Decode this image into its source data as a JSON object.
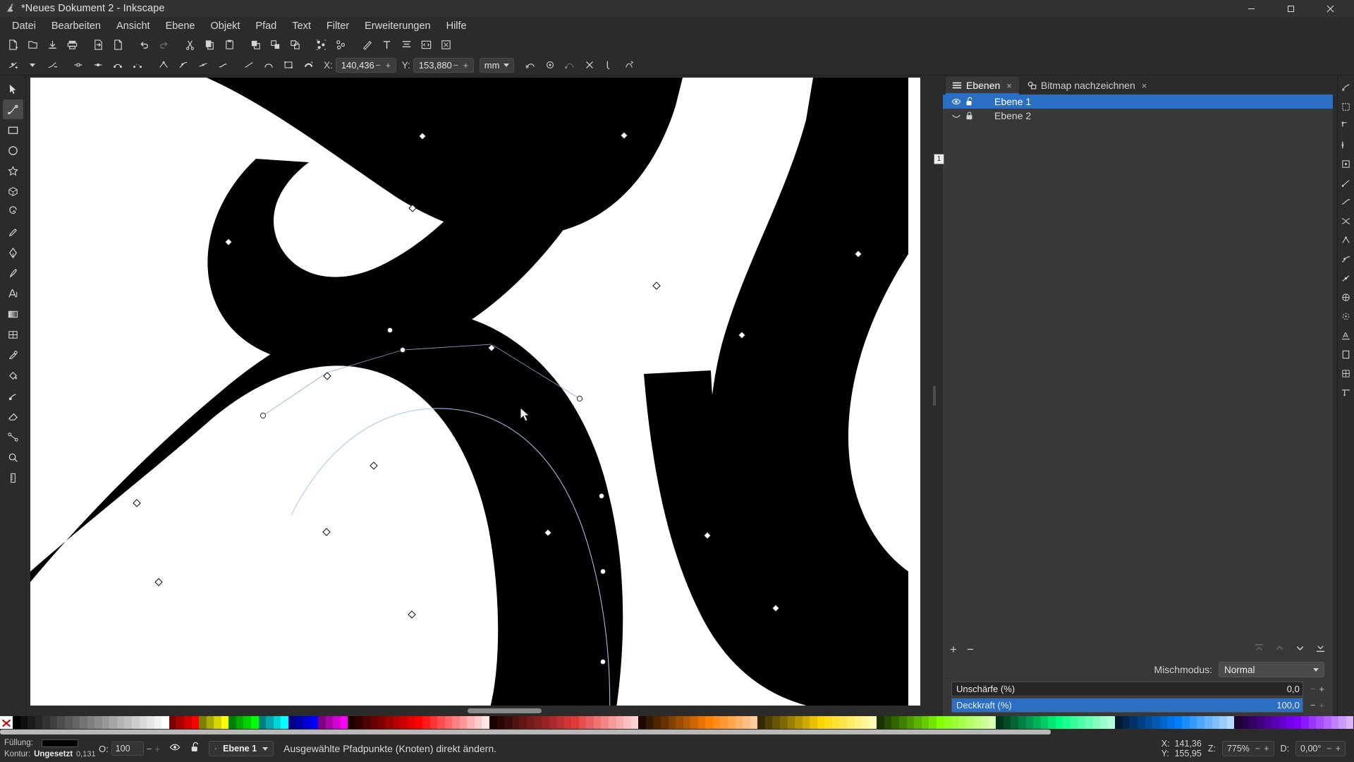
{
  "window": {
    "title": "*Neues Dokument 2 - Inkscape",
    "logo_icon": "inkscape-logo-icon",
    "minimize_label": "–",
    "maximize_label": "❐",
    "close_label": "✕"
  },
  "menubar": {
    "items": [
      {
        "label": "Datei"
      },
      {
        "label": "Bearbeiten"
      },
      {
        "label": "Ansicht"
      },
      {
        "label": "Ebene"
      },
      {
        "label": "Objekt"
      },
      {
        "label": "Pfad"
      },
      {
        "label": "Text"
      },
      {
        "label": "Filter"
      },
      {
        "label": "Erweiterungen"
      },
      {
        "label": "Hilfe"
      }
    ]
  },
  "command_toolbar": {
    "buttons": [
      {
        "name": "new-document-icon"
      },
      {
        "name": "open-document-icon"
      },
      {
        "name": "save-document-icon"
      },
      {
        "name": "print-icon"
      },
      {
        "name": "import-icon"
      },
      {
        "name": "export-icon"
      },
      {
        "name": "undo-icon"
      },
      {
        "name": "redo-icon"
      },
      {
        "name": "cut-icon"
      },
      {
        "name": "copy-icon"
      },
      {
        "name": "paste-icon"
      },
      {
        "name": "duplicate-icon"
      },
      {
        "name": "clone-icon"
      },
      {
        "name": "unlink-clone-icon"
      },
      {
        "name": "group-icon"
      },
      {
        "name": "ungroup-icon"
      },
      {
        "name": "fill-stroke-dialog-icon"
      },
      {
        "name": "text-properties-icon"
      },
      {
        "name": "align-distribute-icon"
      },
      {
        "name": "xml-editor-icon"
      },
      {
        "name": "preferences-icon"
      }
    ]
  },
  "node_toolbar": {
    "buttons": [
      {
        "name": "insert-node-icon"
      },
      {
        "name": "delete-node-icon"
      },
      {
        "name": "break-path-icon"
      },
      {
        "name": "join-nodes-icon"
      },
      {
        "name": "join-segment-icon"
      },
      {
        "name": "delete-segment-icon"
      },
      {
        "name": "node-cusp-icon"
      },
      {
        "name": "node-smooth-icon"
      },
      {
        "name": "node-symmetric-icon"
      },
      {
        "name": "node-auto-icon"
      },
      {
        "name": "segment-line-icon"
      },
      {
        "name": "segment-curve-icon"
      },
      {
        "name": "object-to-path-icon"
      },
      {
        "name": "stroke-to-path-icon"
      }
    ],
    "x_label": "X:",
    "x_value": "140,436",
    "y_label": "Y:",
    "y_value": "153,880",
    "minus_label": "−",
    "plus_label": "+",
    "unit_value": "mm",
    "trailing_buttons": [
      {
        "name": "show-transform-handles-icon"
      },
      {
        "name": "show-path-outline-icon"
      },
      {
        "name": "show-bezier-handles-icon"
      },
      {
        "name": "mask-edit-icon"
      },
      {
        "name": "clip-edit-icon"
      },
      {
        "name": "next-path-effect-icon"
      }
    ]
  },
  "toolbox": {
    "tools": [
      {
        "name": "selector-tool",
        "icon": "arrow-cursor-icon"
      },
      {
        "name": "node-tool",
        "icon": "node-editor-icon",
        "active": true
      },
      {
        "name": "rectangle-tool",
        "icon": "rectangle-icon"
      },
      {
        "name": "ellipse-tool",
        "icon": "ellipse-icon"
      },
      {
        "name": "star-tool",
        "icon": "star-icon"
      },
      {
        "name": "3dbox-tool",
        "icon": "cube-icon"
      },
      {
        "name": "spiral-tool",
        "icon": "spiral-icon"
      },
      {
        "name": "pencil-tool",
        "icon": "pencil-icon"
      },
      {
        "name": "bezier-tool",
        "icon": "bezier-pen-icon"
      },
      {
        "name": "calligraphy-tool",
        "icon": "calligraphy-pen-icon"
      },
      {
        "name": "text-tool",
        "icon": "text-a-icon"
      },
      {
        "name": "gradient-tool",
        "icon": "gradient-icon"
      },
      {
        "name": "mesh-tool",
        "icon": "mesh-gradient-icon"
      },
      {
        "name": "dropper-tool",
        "icon": "eyedropper-icon"
      },
      {
        "name": "paintbucket-tool",
        "icon": "paint-bucket-icon"
      },
      {
        "name": "tweak-tool",
        "icon": "tweak-icon"
      },
      {
        "name": "eraser-tool",
        "icon": "eraser-icon"
      },
      {
        "name": "connector-tool",
        "icon": "connector-icon"
      },
      {
        "name": "zoom-tool",
        "icon": "magnifier-icon"
      },
      {
        "name": "measure-tool",
        "icon": "ruler-icon"
      }
    ]
  },
  "canvas": {
    "page_badge": "1",
    "artwork_color": "#000000",
    "background_color": "#ffffff",
    "node_handle_color": "#ffffff",
    "node_handle_stroke": "#1a1a1a",
    "cursor_icon": "node-cursor-icon"
  },
  "panel": {
    "tabs": [
      {
        "label": "Ebenen",
        "icon": "layers-icon",
        "close": "×",
        "active": true
      },
      {
        "label": "Bitmap nachzeichnen",
        "icon": "trace-bitmap-icon",
        "close": "×",
        "active": false
      }
    ],
    "layers": [
      {
        "name": "Ebene 1",
        "visible_icon": "eye-open-icon",
        "lock_icon": "padlock-open-icon",
        "selected": true
      },
      {
        "name": "Ebene 2",
        "visible_icon": "eye-closed-icon",
        "lock_icon": "padlock-closed-icon",
        "selected": false
      }
    ],
    "add_layer_label": "+",
    "remove_layer_label": "−",
    "raise_top_icon": "raise-to-top-icon",
    "raise_icon": "raise-one-icon",
    "lower_icon": "lower-one-icon",
    "lower_bottom_icon": "lower-to-bottom-icon",
    "blend_label": "Mischmodus:",
    "blend_value": "Normal",
    "blur_label": "Unschärfe (%)",
    "blur_value": "0,0",
    "opacity_label": "Deckkraft (%)",
    "opacity_value": "100,0",
    "opacity_fill_percent": 100,
    "blur_fill_percent": 0,
    "minus_label": "−",
    "plus_label": "+",
    "accent_color": "#2b6fc4"
  },
  "snap_rail": {
    "buttons": [
      {
        "name": "snap-enable-icon"
      },
      {
        "name": "snap-bounding-box-icon"
      },
      {
        "name": "snap-bbox-corner-icon"
      },
      {
        "name": "snap-bbox-edge-icon"
      },
      {
        "name": "snap-bbox-midpoint-icon"
      },
      {
        "name": "snap-nodes-icon"
      },
      {
        "name": "snap-path-icon"
      },
      {
        "name": "snap-path-intersection-icon"
      },
      {
        "name": "snap-cusp-node-icon"
      },
      {
        "name": "snap-smooth-node-icon"
      },
      {
        "name": "snap-midpoint-icon"
      },
      {
        "name": "snap-object-center-icon"
      },
      {
        "name": "snap-rotation-center-icon"
      },
      {
        "name": "snap-text-baseline-icon"
      },
      {
        "name": "snap-page-border-icon"
      },
      {
        "name": "snap-grid-icon"
      },
      {
        "name": "snap-guide-icon"
      }
    ]
  },
  "palette": {
    "none_swatch_icon": "no-color-icon",
    "colors": [
      "#000000",
      "#0d0d0d",
      "#1a1a1a",
      "#262626",
      "#333333",
      "#404040",
      "#4d4d4d",
      "#595959",
      "#666666",
      "#737373",
      "#808080",
      "#8c8c8c",
      "#999999",
      "#a6a6a6",
      "#b3b3b3",
      "#bfbfbf",
      "#cccccc",
      "#d9d9d9",
      "#e6e6e6",
      "#f2f2f2",
      "#ffffff",
      "#800000",
      "#aa0000",
      "#d40000",
      "#ff0000",
      "#808000",
      "#aaaa00",
      "#d4d400",
      "#ffff00",
      "#008000",
      "#00aa00",
      "#00d400",
      "#00ff00",
      "#008080",
      "#00aaaa",
      "#00d4d4",
      "#00ffff",
      "#000080",
      "#0000aa",
      "#0000d4",
      "#0000ff",
      "#800080",
      "#aa00aa",
      "#d400d4",
      "#ff00ff",
      "#1a0000",
      "#330000",
      "#4d0000",
      "#660000",
      "#800000",
      "#990000",
      "#b30000",
      "#cc0000",
      "#e60000",
      "#ff0000",
      "#ff1a1a",
      "#ff3333",
      "#ff4d4d",
      "#ff6666",
      "#ff8080",
      "#ff9999",
      "#ffb3b3",
      "#ffcccc",
      "#ffe6e6",
      "#1a0000",
      "#2b0505",
      "#3d0a0a",
      "#4f1010",
      "#611515",
      "#731a1a",
      "#851f1f",
      "#972424",
      "#a92a2a",
      "#bb2f2f",
      "#cd3434",
      "#df3939",
      "#e64d4d",
      "#ea6060",
      "#ee7373",
      "#f28686",
      "#f59999",
      "#f8acac",
      "#fbbfbf",
      "#fdd2d2",
      "#1a0d00",
      "#331a00",
      "#4d2600",
      "#663300",
      "#804000",
      "#994d00",
      "#b35900",
      "#cc6600",
      "#e67300",
      "#ff8000",
      "#ff8d1a",
      "#ff9933",
      "#ffa64d",
      "#ffb366",
      "#ffbf80",
      "#ffcc99",
      "#332b00",
      "#4d4000",
      "#665500",
      "#806a00",
      "#998000",
      "#b39500",
      "#ccaa00",
      "#e6bf00",
      "#ffd500",
      "#ffdb1a",
      "#ffe033",
      "#ffe54d",
      "#ffeb66",
      "#fff080",
      "#fff599",
      "#fffab3",
      "#1a3300",
      "#264d00",
      "#336600",
      "#408000",
      "#4d9900",
      "#59b300",
      "#66cc00",
      "#73e600",
      "#80ff00",
      "#8dff1a",
      "#99ff33",
      "#a6ff4d",
      "#b3ff66",
      "#bfff80",
      "#ccff99",
      "#d9ffb3",
      "#00331a",
      "#004d26",
      "#006633",
      "#008040",
      "#00994d",
      "#00b359",
      "#00cc66",
      "#00e673",
      "#00ff80",
      "#1aff8d",
      "#33ff99",
      "#4dffa6",
      "#66ffb3",
      "#80ffbf",
      "#99ffcc",
      "#b3ffd9",
      "#001a33",
      "#00264d",
      "#003366",
      "#004080",
      "#004d99",
      "#0059b3",
      "#0066cc",
      "#0073e6",
      "#0080ff",
      "#1a8dff",
      "#3399ff",
      "#4da6ff",
      "#66b3ff",
      "#80bfff",
      "#99ccff",
      "#b3d9ff",
      "#1a0033",
      "#26004d",
      "#330066",
      "#400080",
      "#4d0099",
      "#5900b3",
      "#6600cc",
      "#7300e6",
      "#8000ff",
      "#8d1aff",
      "#9933ff",
      "#a64dff",
      "#b366ff",
      "#bf80ff",
      "#cc99ff",
      "#d9b3ff"
    ]
  },
  "statusbar": {
    "fill_label": "Füllung:",
    "stroke_label": "Kontur:",
    "fill_swatch_color": "#000000",
    "stroke_value": "Ungesetzt",
    "stroke_width": "0,131",
    "opacity_label": "O:",
    "opacity_value": "100",
    "minus_label": "−",
    "plus_label": "+",
    "eye_icon": "eye-open-icon",
    "lock_icon": "padlock-open-icon",
    "layer_indicator_dot": "·",
    "layer_name": "Ebene 1",
    "message": "Ausgewählte Pfadpunkte (Knoten) direkt ändern.",
    "x_label": "X:",
    "x_value": "141,36",
    "y_label": "Y:",
    "y_value": "155,95",
    "zoom_label": "Z:",
    "zoom_value": "775%",
    "rotation_label": "D:",
    "rotation_value": "0,00°"
  }
}
